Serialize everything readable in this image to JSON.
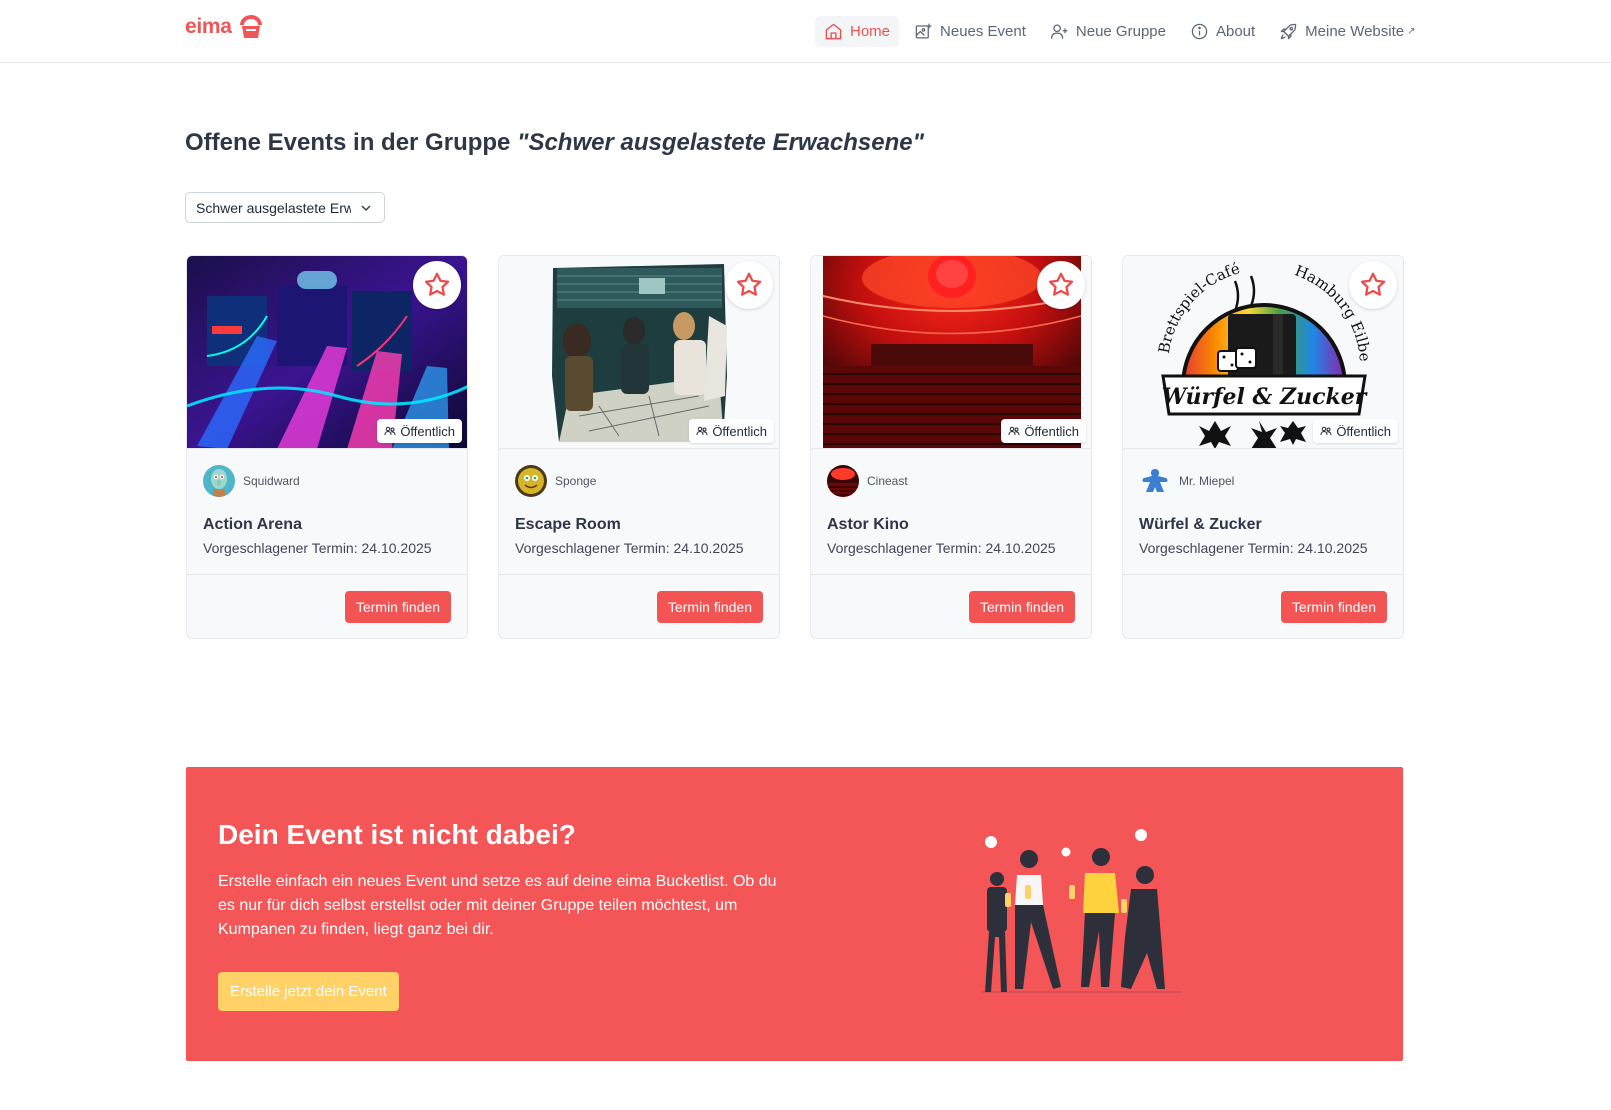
{
  "brand": {
    "name": "eima",
    "accent": "#f25555"
  },
  "nav": {
    "items": [
      {
        "label": "Home",
        "icon": "home-icon",
        "active": true
      },
      {
        "label": "Neues Event",
        "icon": "image-plus-icon",
        "active": false
      },
      {
        "label": "Neue Gruppe",
        "icon": "user-plus-icon",
        "active": false
      },
      {
        "label": "About",
        "icon": "info-icon",
        "active": false
      },
      {
        "label": "Meine Website",
        "icon": "rocket-icon",
        "active": false,
        "external_mark": "↗"
      }
    ]
  },
  "header": {
    "title_prefix": "Offene Events in der Gruppe ",
    "group_quoted": "\"Schwer ausgelastete Erwachsene\""
  },
  "group_select": {
    "value": "Schwer ausgelastete Erwachsene"
  },
  "cards": [
    {
      "owner": "Squidward",
      "title": "Action Arena",
      "date": "Vorgeschlagener Termin: 24.10.2025",
      "badge": "Öffentlich",
      "button": "Termin finden"
    },
    {
      "owner": "Sponge",
      "title": "Escape Room",
      "date": "Vorgeschlagener Termin: 24.10.2025",
      "badge": "Öffentlich",
      "button": "Termin finden"
    },
    {
      "owner": "Cineast",
      "title": "Astor Kino",
      "date": "Vorgeschlagener Termin: 24.10.2025",
      "badge": "Öffentlich",
      "button": "Termin finden"
    },
    {
      "owner": "Mr. Miepel",
      "title": "Würfel & Zucker",
      "date": "Vorgeschlagener Termin: 24.10.2025",
      "badge": "Öffentlich",
      "button": "Termin finden"
    }
  ],
  "logo_cafe": {
    "arc_left": "Brettspiel-Café",
    "arc_right": "Hamburg Eilbek",
    "banner": "Würfel & Zucker"
  },
  "cta": {
    "title": "Dein Event ist nicht dabei?",
    "text": "Erstelle einfach ein neues Event und setze es auf deine eima Bucketlist. Ob du es nur für dich selbst erstellst oder mit deiner Gruppe teilen möchtest, um Kumpanen zu finden, liegt ganz bei dir.",
    "button": "Erstelle jetzt dein Event",
    "background": "#f45556",
    "button_color": "#ffd166"
  }
}
